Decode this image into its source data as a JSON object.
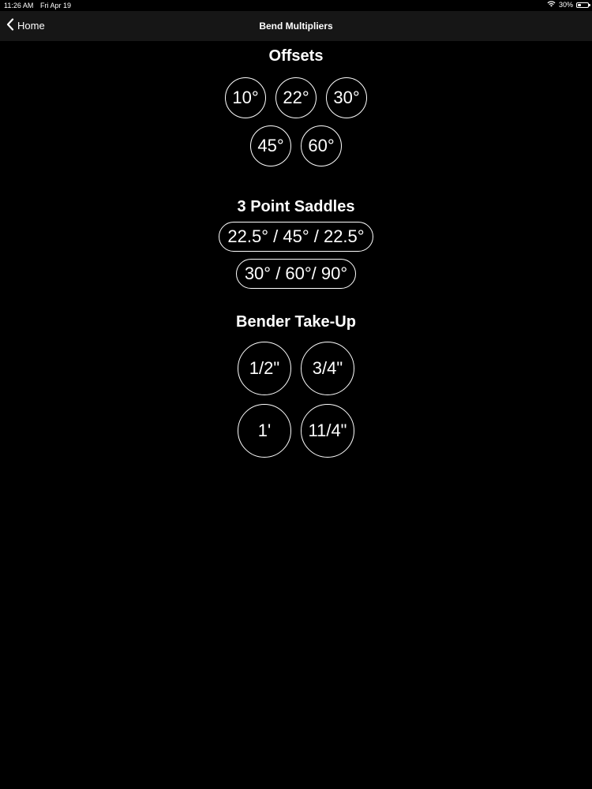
{
  "status_bar": {
    "time": "11:26 AM",
    "date": "Fri Apr 19",
    "battery_text": "30%",
    "battery_level": 0.3,
    "wifi_icon": "wifi-icon",
    "battery_icon": "battery-icon"
  },
  "nav": {
    "back_label": "Home",
    "back_icon": "chevron-left-icon",
    "title": "Bend Multipliers"
  },
  "offsets": {
    "title": "Offsets",
    "row1": [
      "10°",
      "22°",
      "30°"
    ],
    "row2": [
      "45°",
      "60°"
    ]
  },
  "saddles": {
    "title": "3 Point Saddles",
    "items": [
      "22.5° / 45° / 22.5°",
      "30° / 60°/ 90°"
    ]
  },
  "take_up": {
    "title": "Bender Take-Up",
    "row1": [
      "1/2\"",
      "3/4\""
    ],
    "row2": [
      "1'",
      "11/4\""
    ]
  },
  "colors": {
    "background": "#000000",
    "nav_background": "#161616",
    "foreground": "#ffffff"
  }
}
